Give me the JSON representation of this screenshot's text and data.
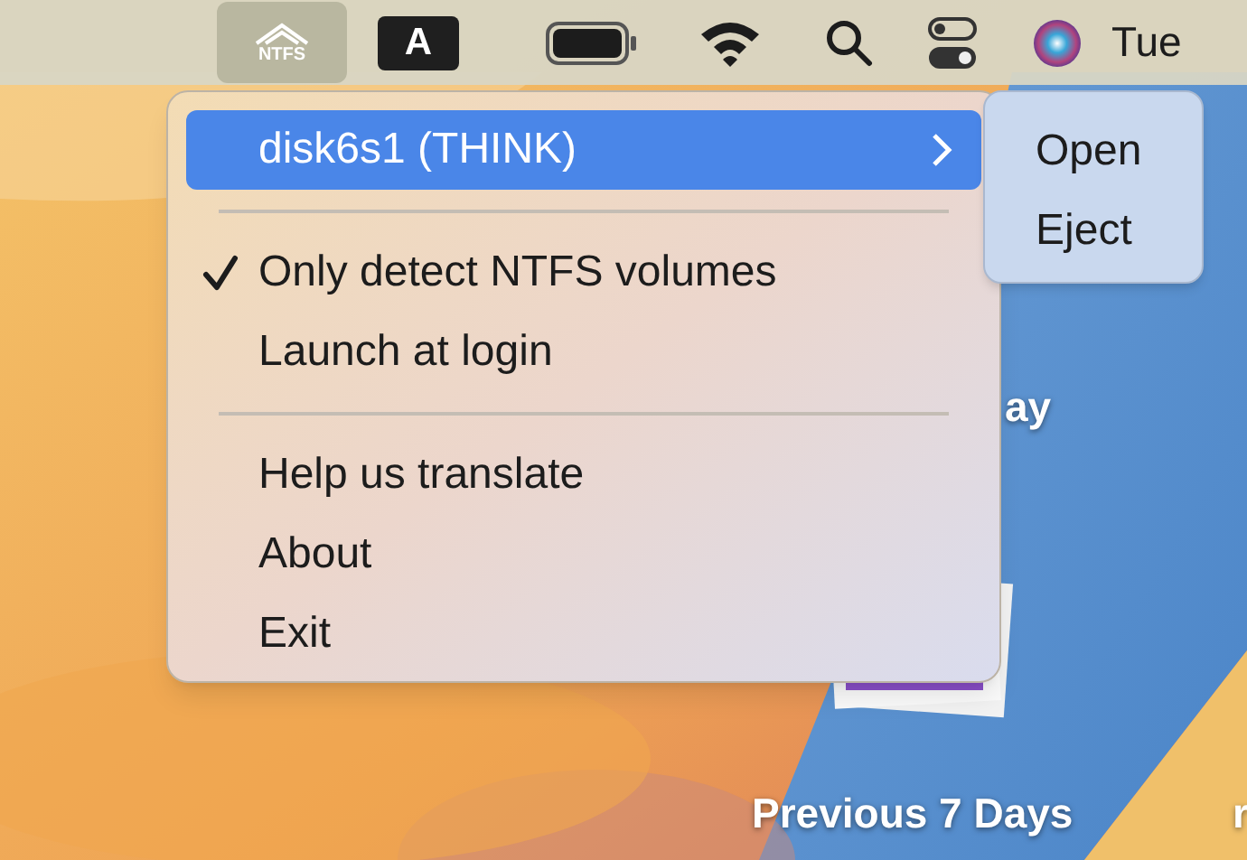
{
  "menu_bar": {
    "ntfs_label": "NTFS",
    "ntfs_active": true,
    "input_source": "A",
    "clock": "Tue"
  },
  "menu": {
    "items": [
      {
        "kind": "item",
        "label": "disk6s1 (THINK)",
        "selected": true,
        "submenu": true,
        "checked": false
      },
      {
        "kind": "separator"
      },
      {
        "kind": "item",
        "label": "Only detect NTFS volumes",
        "selected": false,
        "submenu": false,
        "checked": true
      },
      {
        "kind": "item",
        "label": "Launch at login",
        "selected": false,
        "submenu": false,
        "checked": false
      },
      {
        "kind": "separator"
      },
      {
        "kind": "item",
        "label": "Help us translate",
        "selected": false,
        "submenu": false,
        "checked": false
      },
      {
        "kind": "item",
        "label": "About",
        "selected": false,
        "submenu": false,
        "checked": false
      },
      {
        "kind": "item",
        "label": "Exit",
        "selected": false,
        "submenu": false,
        "checked": false
      }
    ]
  },
  "submenu": {
    "items": [
      {
        "label": "Open"
      },
      {
        "label": "Eject"
      }
    ]
  },
  "desktop": {
    "labels": [
      {
        "text": "ay"
      },
      {
        "text": "Previous 7 Days"
      },
      {
        "text": "r"
      }
    ]
  }
}
